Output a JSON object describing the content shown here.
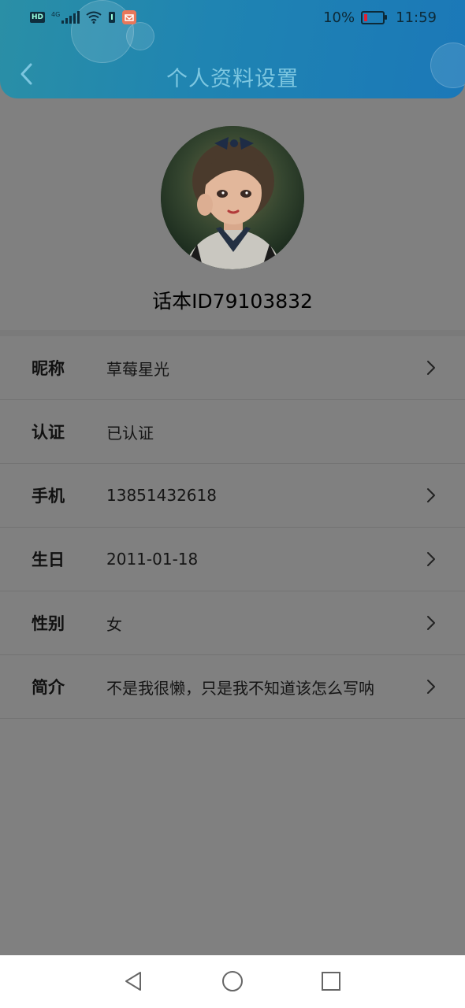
{
  "status_bar": {
    "hd_label": "HD",
    "network_label": "4G",
    "battery_percent": "10%",
    "time": "11:59",
    "battery_level": 0.1,
    "battery_color": "#dd2233"
  },
  "header": {
    "title": "个人资料设置",
    "gradient_colors": [
      "#2a8fa6",
      "#1b78b8"
    ]
  },
  "profile": {
    "id_text": "话本ID79103832"
  },
  "fields": [
    {
      "label": "昵称",
      "value": "草莓星光",
      "chevron": true
    },
    {
      "label": "认证",
      "value": "已认证",
      "chevron": false
    },
    {
      "label": "手机",
      "value": "13851432618",
      "chevron": true
    },
    {
      "label": "生日",
      "value": "2011-01-18",
      "chevron": true
    },
    {
      "label": "性别",
      "value": "女",
      "chevron": true
    },
    {
      "label": "简介",
      "value": "不是我很懒，只是我不知道该怎么写呐",
      "chevron": true
    }
  ],
  "nav_bar": {
    "icons": [
      "back-triangle-icon",
      "home-circle-icon",
      "recents-square-icon"
    ]
  }
}
